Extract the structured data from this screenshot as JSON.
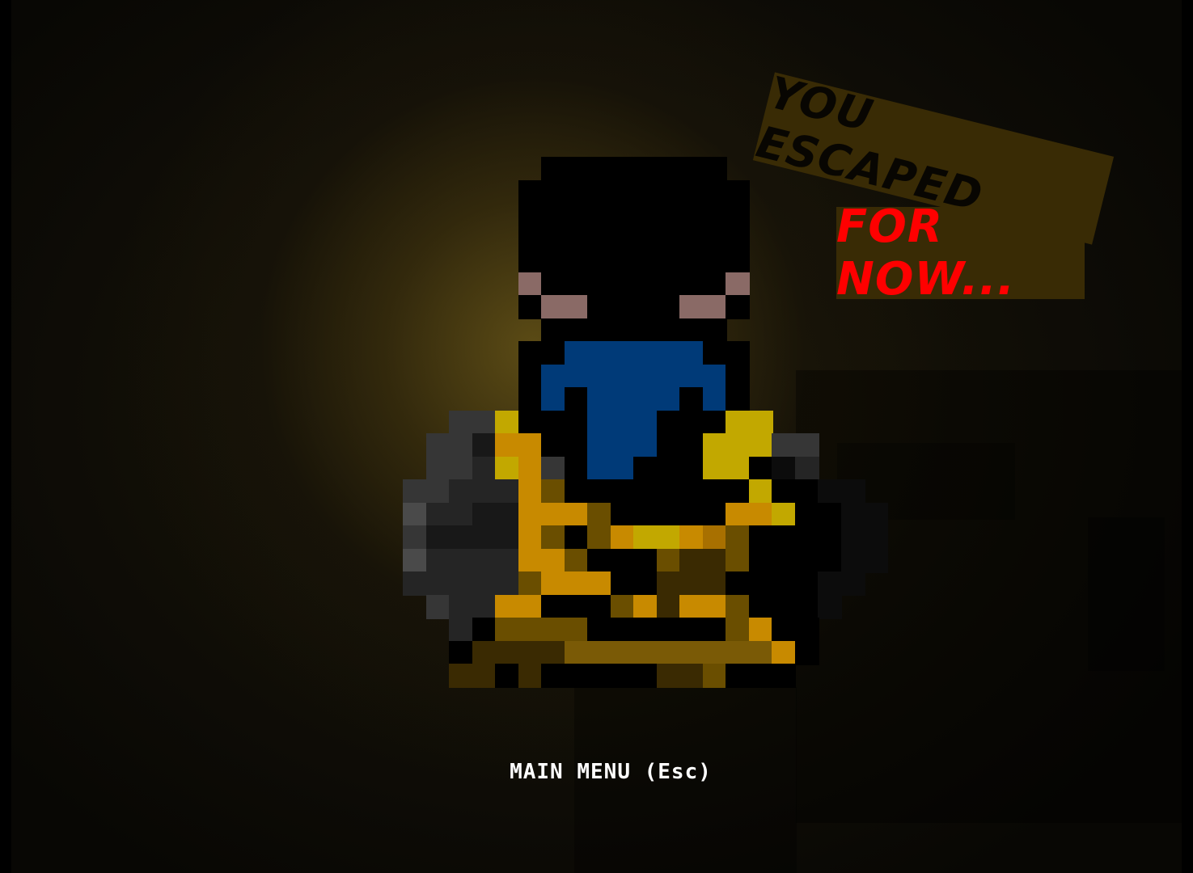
{
  "banner": {
    "line1": "YOU ESCAPED",
    "line2": "FOR NOW..."
  },
  "menu": {
    "main_menu_label": "MAIN MENU (Esc)"
  },
  "colors": {
    "background": "#0a0905",
    "sign": "#392b05",
    "line1_text": "#080602",
    "line2_text": "#ff0000",
    "menu_text": "#ffffff",
    "robe": "#003a78",
    "eyes": "#8a6a66",
    "gold": "#c88a00"
  },
  "character": {
    "name": "hooded-rogue-sprite",
    "holding": "treasure-chest"
  }
}
